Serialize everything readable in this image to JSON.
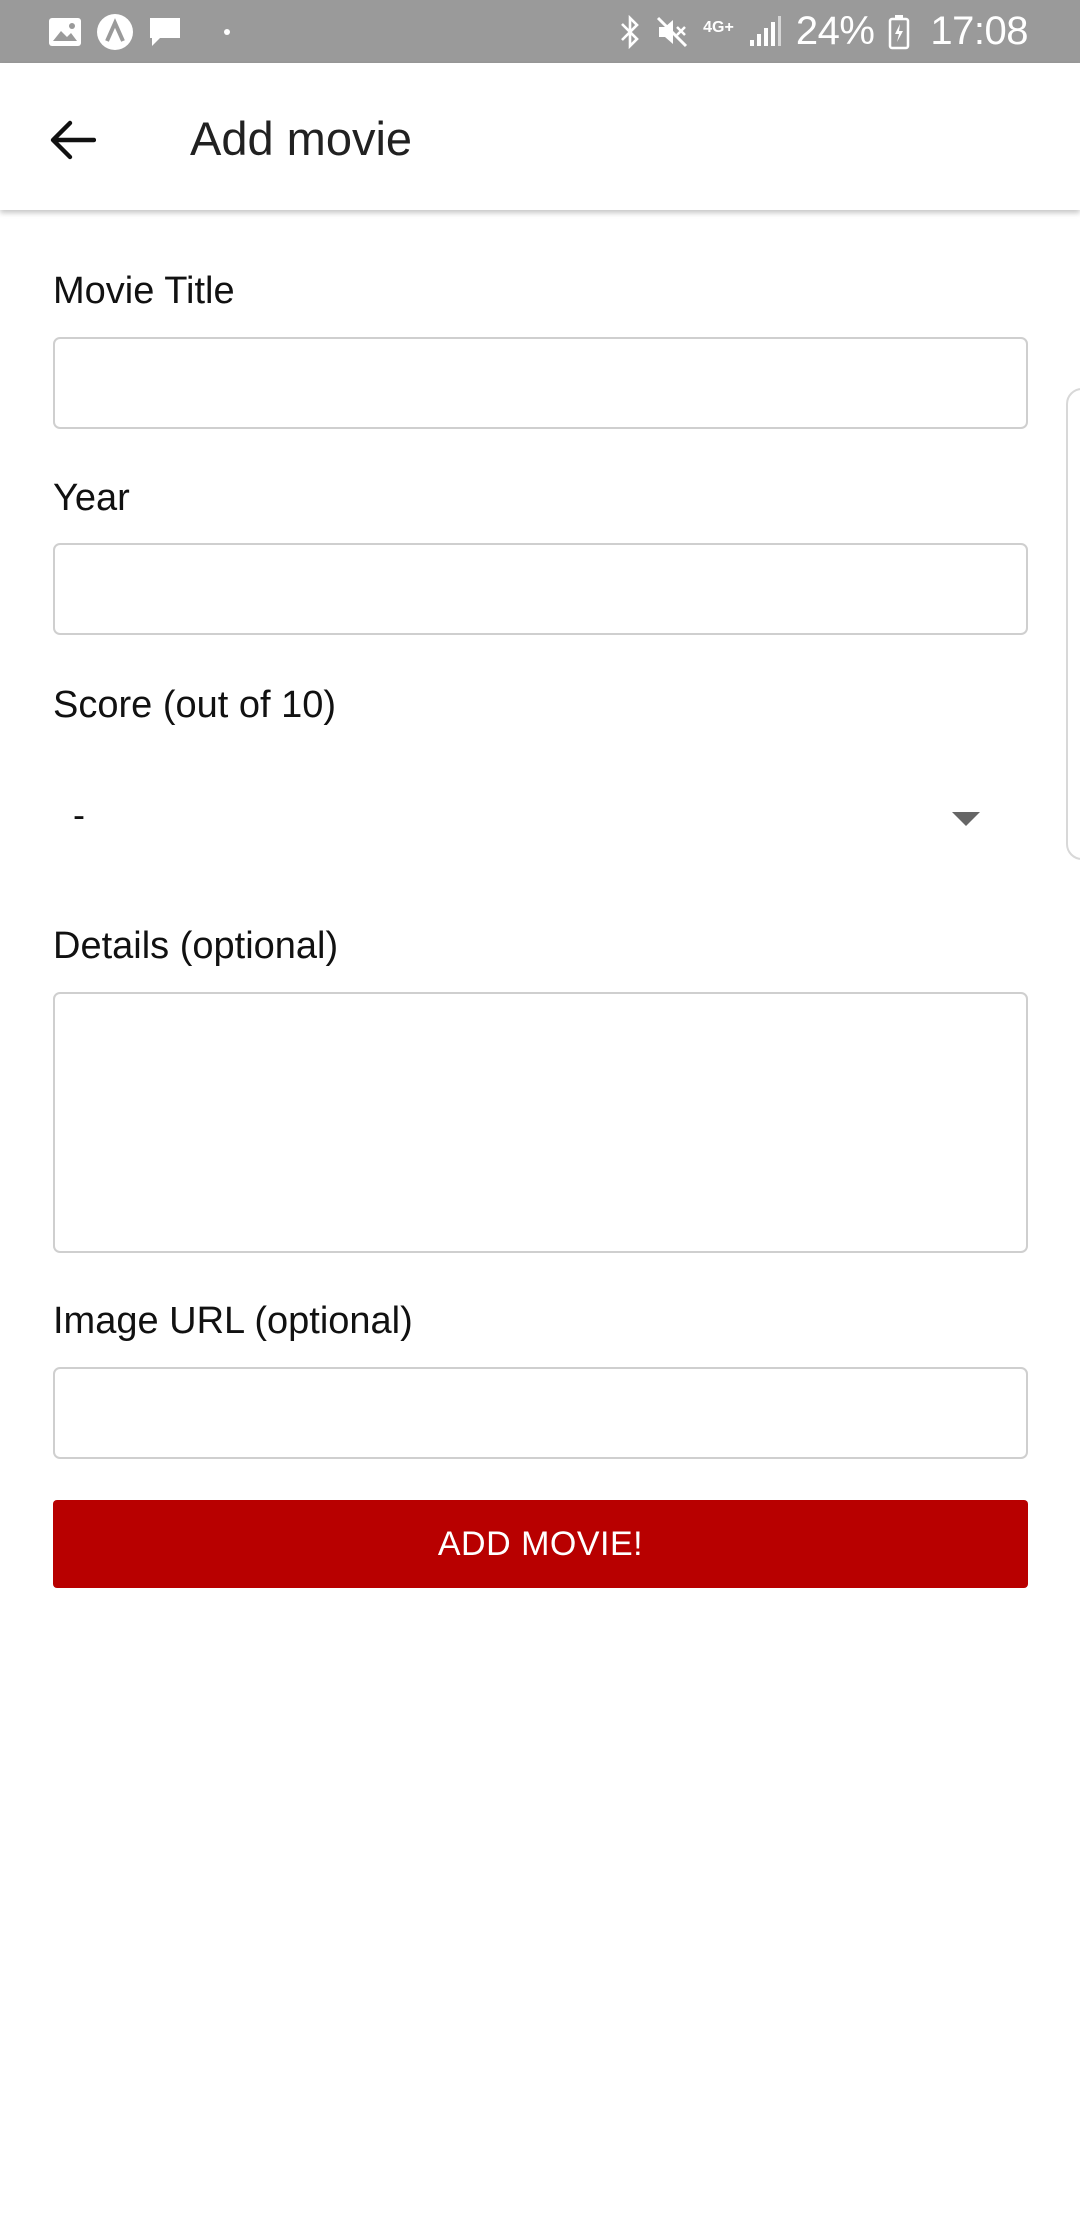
{
  "status_bar": {
    "icons_left": [
      "image-icon",
      "app-a-icon",
      "chat-icon",
      "dot-icon"
    ],
    "network": "4G+",
    "battery_percent": "24%",
    "time": "17:08",
    "icons_right": [
      "bluetooth-icon",
      "mute-icon",
      "signal-icon",
      "battery-icon"
    ]
  },
  "app_bar": {
    "back_icon": "arrow-left-icon",
    "title": "Add movie"
  },
  "form": {
    "title_label": "Movie Title",
    "title_value": "",
    "year_label": "Year",
    "year_value": "",
    "score_label": "Score (out of 10)",
    "score_selected": "-",
    "details_label": "Details (optional)",
    "details_value": "",
    "image_label": "Image URL (optional)",
    "image_value": "",
    "submit_label": "ADD MOVIE!"
  },
  "colors": {
    "status_bar": "#9a9a9a",
    "accent": "#b80000",
    "input_border": "#cfcfcf"
  }
}
